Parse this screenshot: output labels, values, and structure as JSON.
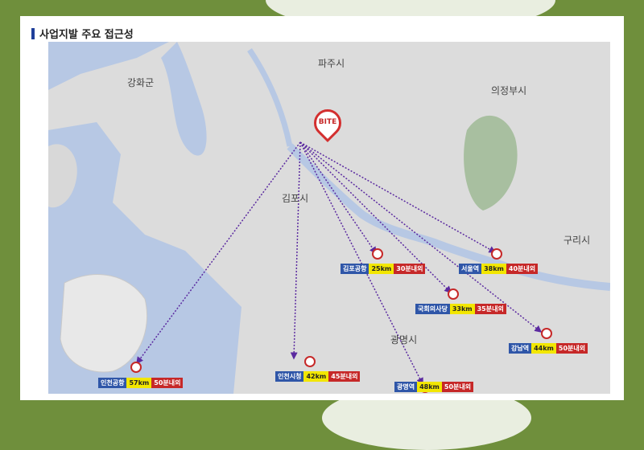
{
  "title": "사업지발 주요 접근성",
  "origin": {
    "label": "BITE"
  },
  "places": [
    {
      "id": "paju",
      "name": "파주시",
      "big": true
    },
    {
      "id": "uijeongbu",
      "name": "의정부시",
      "big": true
    },
    {
      "id": "gangwha",
      "name": "강화군",
      "big": true
    },
    {
      "id": "gimpo",
      "name": "김포시",
      "big": true
    },
    {
      "id": "guri",
      "name": "구리시",
      "big": true
    },
    {
      "id": "gwangmyeong",
      "name": "광명시",
      "big": true
    }
  ],
  "destinations": [
    {
      "id": "gimpo-airport",
      "name": "김포공항",
      "distance": "25km",
      "time": "30분내외"
    },
    {
      "id": "seoul-station",
      "name": "서울역",
      "distance": "38km",
      "time": "40분내외"
    },
    {
      "id": "national-assembly",
      "name": "국회의사당",
      "distance": "33km",
      "time": "35분내외"
    },
    {
      "id": "gangnam-station",
      "name": "강남역",
      "distance": "44km",
      "time": "50분내외"
    },
    {
      "id": "incheon-city-hall",
      "name": "인천시청",
      "distance": "42km",
      "time": "45분내외"
    },
    {
      "id": "incheon-airport",
      "name": "인천공항",
      "distance": "57km",
      "time": "50분내외"
    },
    {
      "id": "gwangmyeong-station",
      "name": "광명역",
      "distance": "48km",
      "time": "50분내외"
    }
  ],
  "colors": {
    "accent": "#1f3f9a",
    "route": "#5b2aa0",
    "marker": "#c62828",
    "highlight": "#f2e600"
  }
}
